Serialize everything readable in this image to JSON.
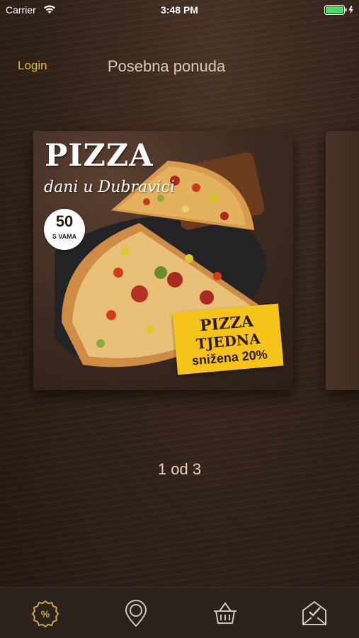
{
  "status_bar": {
    "carrier": "Carrier",
    "time": "3:48 PM",
    "icons": [
      "wifi-icon",
      "battery-charging-icon"
    ]
  },
  "nav": {
    "login_label": "Login",
    "title": "Posebna ponuda"
  },
  "carousel": {
    "current_card": {
      "headline": "PIZZA",
      "subheadline": "dani u Dubravici",
      "badge_number": "50",
      "badge_text": "S VAMA",
      "promo_line1": "PIZZA",
      "promo_line2": "TJEDNA",
      "promo_line3": "snižena 20%"
    },
    "pager": "1 od 3"
  },
  "tab_bar": {
    "tabs": [
      {
        "icon": "discount-icon",
        "active": true
      },
      {
        "icon": "location-pin-icon",
        "active": false
      },
      {
        "icon": "basket-icon",
        "active": false
      },
      {
        "icon": "inbox-check-icon",
        "active": false
      }
    ]
  },
  "colors": {
    "accent": "#f0b818",
    "tab_active": "#c9a64a",
    "tab_inactive": "#cfc4bb",
    "tab_bar_bg": "#2b221d",
    "sticker": "#f5c319"
  }
}
